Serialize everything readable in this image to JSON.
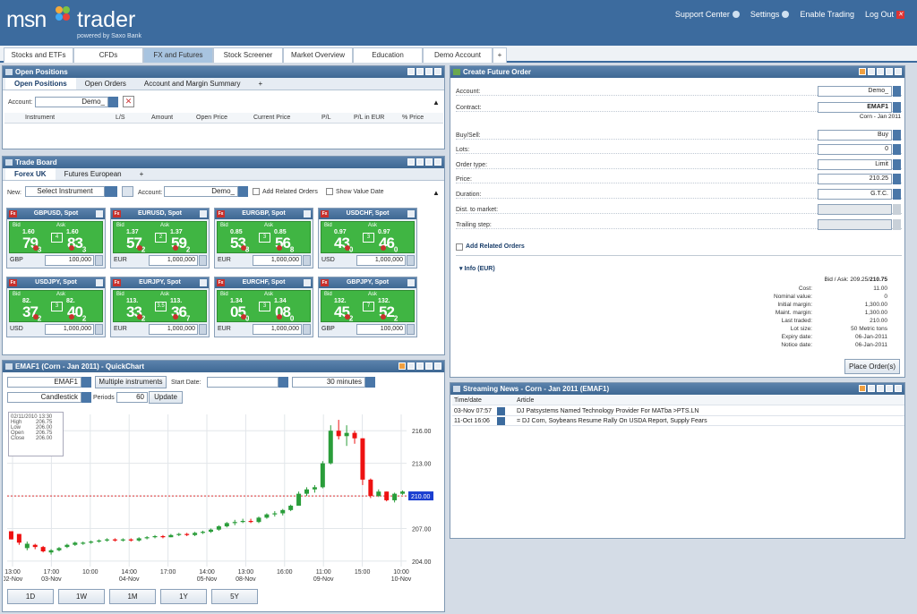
{
  "app": {
    "logo": "msn",
    "logo_trader": "trader",
    "powered": "powered by Saxo Bank",
    "links": [
      "Support Center",
      "Settings",
      "Enable Trading",
      "Log Out"
    ]
  },
  "tabs": [
    "Stocks and ETFs",
    "CFDs",
    "FX and Futures",
    "Stock Screener",
    "Market Overview",
    "Education",
    "Demo Account",
    "+"
  ],
  "open_positions": {
    "title": "Open Positions",
    "tabs": [
      "Open Positions",
      "Open Orders",
      "Account and Margin Summary",
      "+"
    ],
    "account_label": "Account:",
    "account_value": "Demo_",
    "columns": [
      "Instrument",
      "L/S",
      "Amount",
      "Open Price",
      "Current Price",
      "P/L",
      "P/L in EUR",
      "% Price"
    ]
  },
  "trade_board": {
    "title": "Trade Board",
    "tabs": [
      "Forex UK",
      "Futures European",
      "+"
    ],
    "new_label": "New:",
    "select_instrument": "Select Instrument",
    "account_label": "Account:",
    "account_value": "Demo_",
    "add_related": "Add Related Orders",
    "show_value_date": "Show Value Date",
    "tiles": [
      {
        "name": "GBPUSD, Spot",
        "bid_big": "1.60",
        "bid": "79",
        "bid_pip": "3",
        "ask_big": "1.60",
        "ask": "83",
        "ask_pip": "3",
        "spread": "4",
        "ccy": "GBP",
        "amount": "100,000"
      },
      {
        "name": "EURUSD, Spot",
        "bid_big": "1.37",
        "bid": "57",
        "bid_pip": "2",
        "ask_big": "1.37",
        "ask": "59",
        "ask_pip": "2",
        "spread": "2",
        "ccy": "EUR",
        "amount": "1,000,000"
      },
      {
        "name": "EURGBP, Spot",
        "bid_big": "0.85",
        "bid": "53",
        "bid_pip": "8",
        "ask_big": "0.85",
        "ask": "56",
        "ask_pip": "8",
        "spread": "3",
        "ccy": "EUR",
        "amount": "1,000,000"
      },
      {
        "name": "USDCHF, Spot",
        "bid_big": "0.97",
        "bid": "43",
        "bid_pip": "0",
        "ask_big": "0.97",
        "ask": "46",
        "ask_pip": "0",
        "spread": "3",
        "ccy": "USD",
        "amount": "1,000,000"
      },
      {
        "name": "USDJPY, Spot",
        "bid_big": "82.",
        "bid": "37",
        "bid_pip": "2",
        "ask_big": "82.",
        "ask": "40",
        "ask_pip": "2",
        "spread": "3",
        "ccy": "USD",
        "amount": "1,000,000"
      },
      {
        "name": "EURJPY, Spot",
        "bid_big": "113.",
        "bid": "33",
        "bid_pip": "2",
        "ask_big": "113.",
        "ask": "36",
        "ask_pip": "7",
        "spread": "3.5",
        "ccy": "EUR",
        "amount": "1,000,000"
      },
      {
        "name": "EURCHF, Spot",
        "bid_big": "1.34",
        "bid": "05",
        "bid_pip": "0",
        "ask_big": "1.34",
        "ask": "08",
        "ask_pip": "0",
        "spread": "3",
        "ccy": "EUR",
        "amount": "1,000,000"
      },
      {
        "name": "GBPJPY, Spot",
        "bid_big": "132.",
        "bid": "45",
        "bid_pip": "2",
        "ask_big": "132.",
        "ask": "52",
        "ask_pip": "2",
        "spread": "7",
        "ccy": "GBP",
        "amount": "100,000"
      }
    ]
  },
  "quickchart": {
    "title": "EMAF1 (Corn - Jan 2011) - QuickChart",
    "symbol": "EMAF1",
    "multi_btn": "Multiple instruments",
    "start_label": "Start Date:",
    "interval": "30 minutes",
    "type": "Candlestick",
    "periods_label": "Periods",
    "periods": "60",
    "update": "Update",
    "ranges": [
      "1D",
      "1W",
      "1M",
      "1Y",
      "5Y"
    ],
    "tooltip": {
      "date": "02/11/2010 13:30",
      "rows": [
        [
          "High",
          "206.75"
        ],
        [
          "Low",
          "206.00"
        ],
        [
          "Open",
          "206.75"
        ],
        [
          "Close",
          "206.00"
        ]
      ]
    },
    "price_tag": "210.00"
  },
  "chart_data": {
    "type": "candlestick",
    "y_ticks": [
      "216.00",
      "213.00",
      "210.00",
      "207.00",
      "204.00"
    ],
    "ylim": [
      203.5,
      217.5
    ],
    "current": 210.0,
    "x_ticks": [
      {
        "t": "13:00",
        "d": "02-Nov"
      },
      {
        "t": "17:00",
        "d": "03-Nov"
      },
      {
        "t": "10:00",
        "d": ""
      },
      {
        "t": "14:00",
        "d": "04-Nov"
      },
      {
        "t": "17:00",
        "d": ""
      },
      {
        "t": "14:00",
        "d": "05-Nov"
      },
      {
        "t": "13:00",
        "d": "08-Nov"
      },
      {
        "t": "16:00",
        "d": ""
      },
      {
        "t": "11:00",
        "d": "09-Nov"
      },
      {
        "t": "15:00",
        "d": ""
      },
      {
        "t": "10:00",
        "d": "10-Nov"
      }
    ],
    "candles": [
      [
        206.75,
        206.0,
        206.75,
        206.0
      ],
      [
        206.5,
        205.5,
        206.5,
        205.7
      ],
      [
        205.8,
        205.0,
        205.2,
        205.6
      ],
      [
        205.6,
        205.1,
        205.5,
        205.3
      ],
      [
        205.4,
        204.8,
        205.3,
        204.9
      ],
      [
        205.1,
        204.6,
        204.8,
        205.0
      ],
      [
        205.3,
        204.9,
        205.0,
        205.2
      ],
      [
        205.6,
        205.2,
        205.3,
        205.5
      ],
      [
        205.8,
        205.4,
        205.5,
        205.7
      ],
      [
        205.8,
        205.5,
        205.6,
        205.7
      ],
      [
        205.9,
        205.6,
        205.7,
        205.8
      ],
      [
        206.0,
        205.7,
        205.8,
        205.9
      ],
      [
        206.1,
        205.8,
        205.9,
        206.0
      ],
      [
        206.1,
        205.8,
        206.0,
        205.9
      ],
      [
        206.1,
        205.8,
        205.9,
        206.0
      ],
      [
        206.1,
        205.8,
        206.0,
        205.9
      ],
      [
        206.2,
        205.8,
        205.9,
        206.1
      ],
      [
        206.3,
        206.0,
        206.1,
        206.2
      ],
      [
        206.4,
        206.1,
        206.2,
        206.3
      ],
      [
        206.4,
        206.1,
        206.3,
        206.2
      ],
      [
        206.5,
        206.2,
        206.2,
        206.4
      ],
      [
        206.6,
        206.3,
        206.4,
        206.5
      ],
      [
        206.6,
        206.3,
        206.5,
        206.4
      ],
      [
        206.7,
        206.3,
        206.4,
        206.6
      ],
      [
        206.8,
        206.5,
        206.6,
        206.7
      ],
      [
        207.0,
        206.6,
        206.7,
        206.9
      ],
      [
        207.3,
        206.8,
        206.9,
        207.2
      ],
      [
        207.6,
        207.1,
        207.2,
        207.5
      ],
      [
        207.8,
        207.3,
        207.5,
        207.6
      ],
      [
        207.9,
        207.5,
        207.6,
        207.7
      ],
      [
        207.9,
        207.5,
        207.7,
        207.6
      ],
      [
        208.1,
        207.5,
        207.6,
        208.0
      ],
      [
        208.4,
        207.9,
        208.0,
        208.3
      ],
      [
        208.6,
        208.1,
        208.3,
        208.4
      ],
      [
        208.8,
        208.2,
        208.4,
        208.7
      ],
      [
        209.2,
        208.6,
        208.7,
        209.1
      ],
      [
        210.4,
        209.1,
        209.1,
        210.2
      ],
      [
        210.8,
        210.0,
        210.2,
        210.6
      ],
      [
        211.0,
        210.3,
        210.6,
        210.8
      ],
      [
        213.2,
        210.7,
        210.8,
        213.0
      ],
      [
        216.5,
        212.9,
        213.0,
        216.0
      ],
      [
        217.0,
        215.2,
        216.0,
        215.5
      ],
      [
        216.5,
        214.6,
        215.5,
        215.8
      ],
      [
        216.0,
        214.8,
        215.8,
        215.3
      ],
      [
        215.3,
        211.0,
        215.3,
        211.5
      ],
      [
        211.6,
        209.8,
        211.5,
        210.0
      ],
      [
        210.6,
        209.9,
        210.0,
        210.4
      ],
      [
        210.4,
        209.5,
        210.4,
        209.6
      ],
      [
        210.3,
        209.4,
        209.6,
        210.2
      ],
      [
        210.5,
        210.1,
        210.2,
        210.4
      ]
    ]
  },
  "order": {
    "title": "Create Future Order",
    "rows": [
      {
        "label": "Account:",
        "value": "Demo_"
      },
      {
        "label": "Contract:",
        "value": "EMAF1",
        "sub": "Corn - Jan 2011"
      },
      {
        "label": "Buy/Sell:",
        "value": "Buy"
      },
      {
        "label": "Lots:",
        "value": "0"
      },
      {
        "label": "Order type:",
        "value": "Limit"
      },
      {
        "label": "Price:",
        "value": "210.25"
      },
      {
        "label": "Duration:",
        "value": "G.T.C."
      },
      {
        "label": "Dist. to market:",
        "value": ""
      },
      {
        "label": "Trailing step:",
        "value": ""
      }
    ],
    "add_related": "Add Related Orders",
    "info": "Info (EUR)",
    "bidask_label": "Bid / Ask:",
    "bid": "209.25",
    "ask": "210.75",
    "info_rows": [
      [
        "Cost:",
        "11.00"
      ],
      [
        "Nominal value:",
        "0"
      ],
      [
        "Initial margin:",
        "1,300.00"
      ],
      [
        "Maint. margin:",
        "1,300.00"
      ],
      [
        "Last traded:",
        "210.00"
      ],
      [
        "Lot size:",
        "50 Metric tons"
      ],
      [
        "Expiry date:",
        "06-Jan-2011"
      ],
      [
        "Notice date:",
        "06-Jan-2011"
      ]
    ],
    "place": "Place Order(s)"
  },
  "news": {
    "title": "Streaming News - Corn - Jan 2011 (EMAF1)",
    "col_time": "Time/date",
    "col_article": "Article",
    "items": [
      [
        "03-Nov 07:57",
        "DJ Patsystems Named Technology Provider For MATba >PTS.LN"
      ],
      [
        "11-Oct 16:06",
        "= DJ Corn, Soybeans Resume Rally On USDA Report, Supply Fears"
      ]
    ]
  }
}
